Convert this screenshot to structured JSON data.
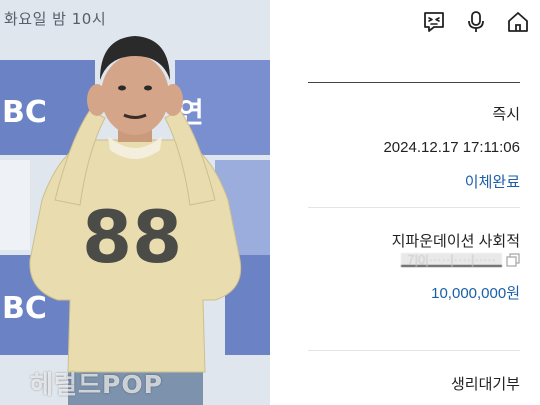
{
  "photo": {
    "caption": "화요일 밤 10시",
    "watermark": "헤럴드POP",
    "sweater_number": "88",
    "backdrop_texts": [
      "BC",
      "BC",
      "연"
    ]
  },
  "toolbar": {
    "icons": [
      "chat-bot-icon",
      "microphone-icon",
      "home-icon"
    ]
  },
  "transaction": {
    "type": "즉시",
    "datetime": "2024.12.17 17:11:06",
    "status": "이체완료"
  },
  "recipient": {
    "name": "지파운데이션 사회적",
    "account_masked": "7|0|·····|····|·····",
    "amount": "10,000,000원"
  },
  "footer": {
    "memo": "생리대기부"
  },
  "colors": {
    "accent_blue": "#1a5fa8",
    "text_dark": "#222222",
    "divider": "#e4e4e4"
  }
}
